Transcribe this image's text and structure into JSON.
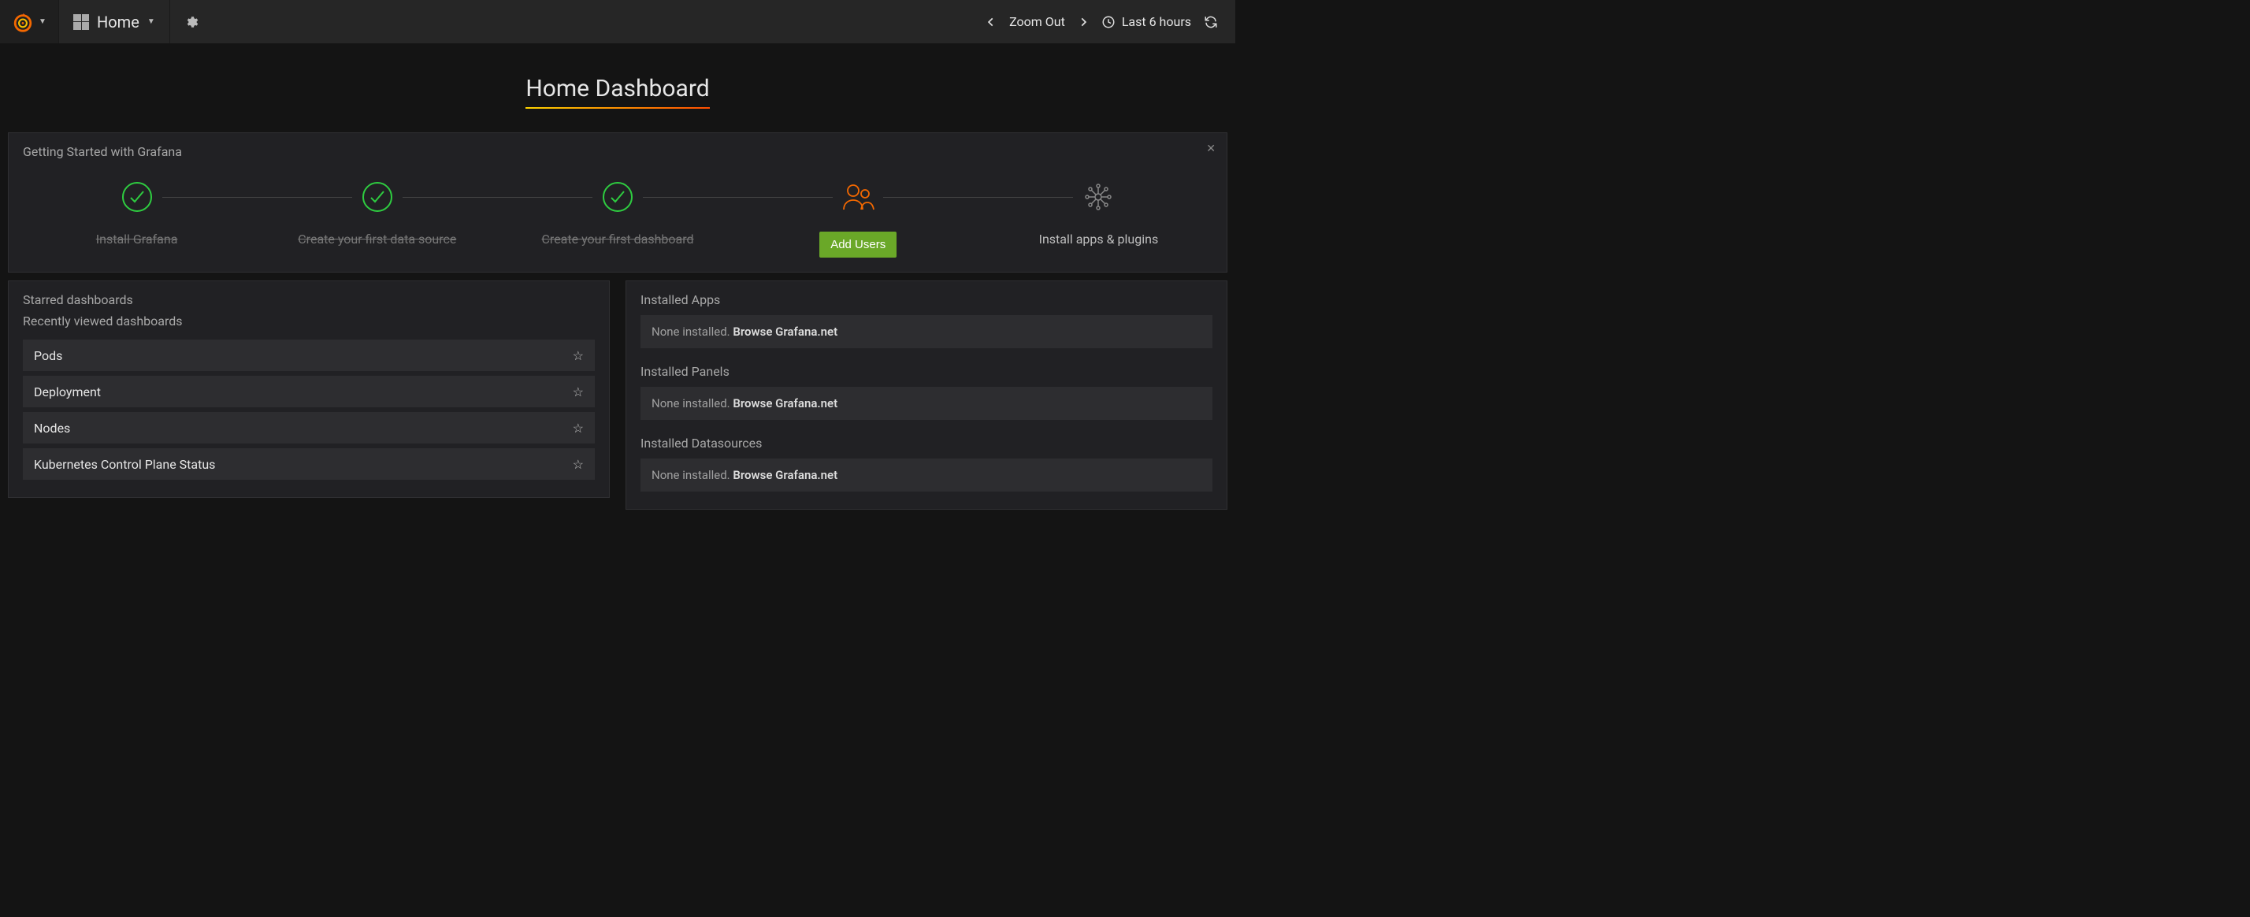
{
  "navbar": {
    "home_label": "Home",
    "zoom_out": "Zoom Out",
    "time_range": "Last 6 hours"
  },
  "page": {
    "title": "Home Dashboard"
  },
  "getting_started": {
    "title": "Getting Started with Grafana",
    "steps": [
      {
        "label": "Install Grafana",
        "state": "done"
      },
      {
        "label": "Create your first data source",
        "state": "done"
      },
      {
        "label": "Create your first dashboard",
        "state": "done"
      },
      {
        "label": "Add Users",
        "state": "action"
      },
      {
        "label": "Install apps & plugins",
        "state": "pending"
      }
    ]
  },
  "dashboards": {
    "starred_title": "Starred dashboards",
    "recent_title": "Recently viewed dashboards",
    "items": [
      {
        "name": "Pods"
      },
      {
        "name": "Deployment"
      },
      {
        "name": "Nodes"
      },
      {
        "name": "Kubernetes Control Plane Status"
      }
    ]
  },
  "installed": {
    "sections": [
      {
        "title": "Installed Apps",
        "none_text": "None installed. ",
        "link": "Browse Grafana.net"
      },
      {
        "title": "Installed Panels",
        "none_text": "None installed. ",
        "link": "Browse Grafana.net"
      },
      {
        "title": "Installed Datasources",
        "none_text": "None installed. ",
        "link": "Browse Grafana.net"
      }
    ]
  }
}
